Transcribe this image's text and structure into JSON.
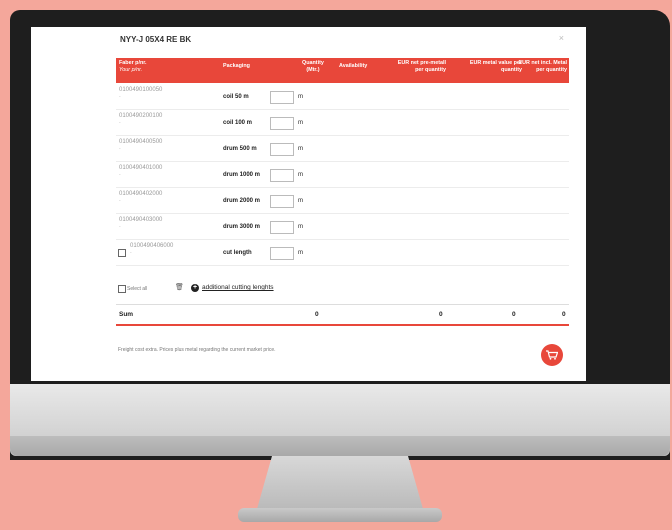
{
  "modal": {
    "title": "NYY-J 05X4 RE BK",
    "close": "×"
  },
  "header": {
    "col1_line1": "Faber p/nr.",
    "col1_line2": "Your p/nr.",
    "col2": "Packaging",
    "col3_line1": "Quantity",
    "col3_line2": "(Mtr.)",
    "col4": "Availability",
    "col5_line1": "EUR net pre-metall",
    "col5_line2": "per quantity",
    "col6_line1": "EUR metal value per",
    "col6_line2": "quantity",
    "col7_line1": "EUR net incl. Metal",
    "col7_line2": "per quantity"
  },
  "rows": [
    {
      "pn": "0100490100050",
      "pkg": "coil 50 m",
      "unit": "m"
    },
    {
      "pn": "0100490200100",
      "pkg": "coil 100 m",
      "unit": "m"
    },
    {
      "pn": "0100490400500",
      "pkg": "drum 500 m",
      "unit": "m"
    },
    {
      "pn": "0100490401000",
      "pkg": "drum 1000 m",
      "unit": "m"
    },
    {
      "pn": "0100490402000",
      "pkg": "drum 2000 m",
      "unit": "m"
    },
    {
      "pn": "0100490403000",
      "pkg": "drum 3000 m",
      "unit": "m"
    },
    {
      "pn": "0100490406000",
      "pkg": "cut length",
      "unit": "m"
    }
  ],
  "controls": {
    "select_all": "Select all",
    "additional": "additional cutting lenghts"
  },
  "sum": {
    "label": "Sum",
    "v1": "0",
    "v2": "0",
    "v3": "0",
    "v4": "0"
  },
  "footer": {
    "note": "Freight cost extra. Prices plus metal regarding the current market price."
  },
  "colors": {
    "accent": "#e8473a",
    "background": "#f4a79b"
  },
  "icons": [
    "close-icon",
    "trash-icon",
    "plus-circle-icon",
    "cart-icon"
  ]
}
